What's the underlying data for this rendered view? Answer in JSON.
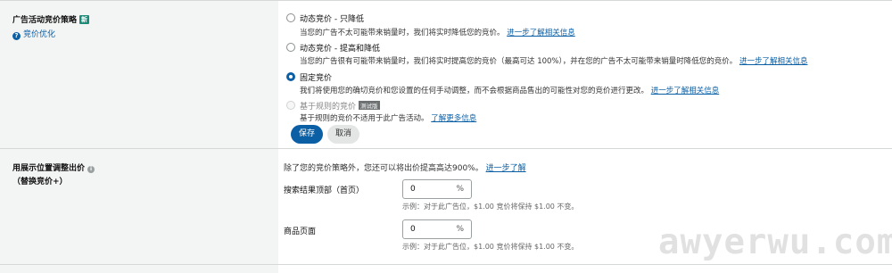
{
  "bidding_strategy": {
    "label": "广告活动竞价策略",
    "badge": "新",
    "help_link": "竞价优化",
    "options": [
      {
        "title": "动态竞价 - 只降低",
        "desc": "当您的广告不太可能带来销量时，我们将实时降低您的竞价。",
        "link": "进一步了解相关信息",
        "selected": false,
        "disabled": false
      },
      {
        "title": "动态竞价 - 提高和降低",
        "desc": "当您的广告很有可能带来销量时，我们将实时提高您的竞价（最高可达 100%），并在您的广告不太可能带来销量时降低您的竞价。",
        "link": "进一步了解相关信息",
        "selected": false,
        "disabled": false
      },
      {
        "title": "固定竞价",
        "desc": "我们将使用您的确切竞价和您设置的任何手动调整，而不会根据商品售出的可能性对您的竞价进行更改。",
        "link": "进一步了解相关信息",
        "selected": true,
        "disabled": false
      },
      {
        "title": "基于规则的竞价",
        "badge": "测试版",
        "desc": "基于规则的竞价不适用于此广告活动。",
        "link": "了解更多信息",
        "selected": false,
        "disabled": true
      }
    ],
    "save_label": "保存",
    "cancel_label": "取消"
  },
  "placement": {
    "label": "用展示位置调整出价",
    "sublabel": "（替换竞价+）",
    "intro": "除了您的竞价策略外，您还可以将出价提高高达900%。",
    "intro_link": "进一步了解",
    "fields": [
      {
        "label": "搜索结果顶部（首页）",
        "value": "0",
        "unit": "%",
        "hint": "示例：对于此广告位，$1.00 竞价将保持 $1.00 不变。"
      },
      {
        "label": "商品页面",
        "value": "0",
        "unit": "%",
        "hint": "示例：对于此广告位，$1.00 竞价将保持 $1.00 不变。"
      }
    ]
  },
  "watermark": "awyerwu.com",
  "colors": {
    "accent": "#0b5fa5",
    "badge": "#1a8a79",
    "panel": "#f3f4f4"
  }
}
